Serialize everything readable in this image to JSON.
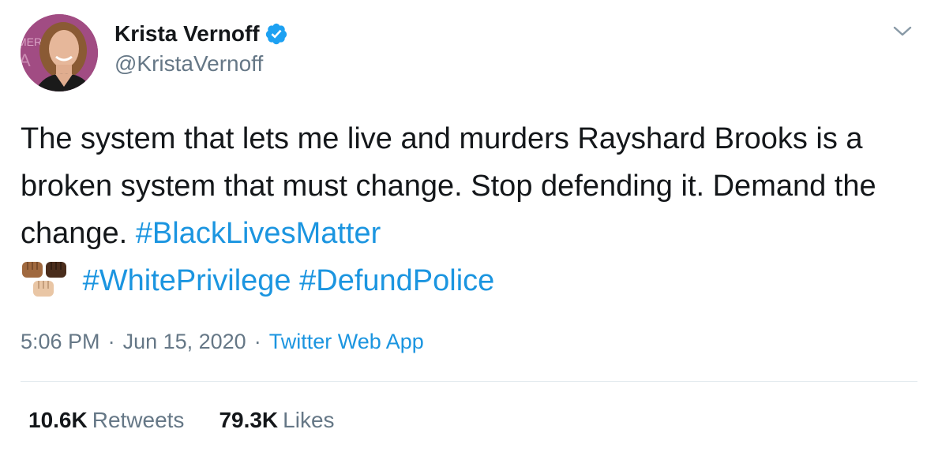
{
  "author": {
    "display_name": "Krista Vernoff",
    "handle": "@KristaVernoff",
    "verified": true
  },
  "tweet": {
    "text_plain": "The system that lets me live and murders Rayshard Brooks is a broken system that must change. Stop defending it. Demand the change.",
    "emoji": "✊🏽✊🏿✊🏼",
    "hashtags": [
      "#BlackLivesMatter",
      "#WhitePrivilege",
      "#DefundPolice"
    ]
  },
  "meta": {
    "time": "5:06 PM",
    "separator": "·",
    "date": "Jun 15, 2020",
    "source": "Twitter Web App"
  },
  "stats": {
    "retweets_count": "10.6K",
    "retweets_label": "Retweets",
    "likes_count": "79.3K",
    "likes_label": "Likes"
  },
  "colors": {
    "link": "#1b95e0",
    "text": "#14171a",
    "muted": "#657786",
    "divider": "#e1e8ed",
    "verified": "#1da1f2"
  },
  "icons": {
    "verified": "verified-badge-icon",
    "caret": "chevron-down-icon"
  }
}
